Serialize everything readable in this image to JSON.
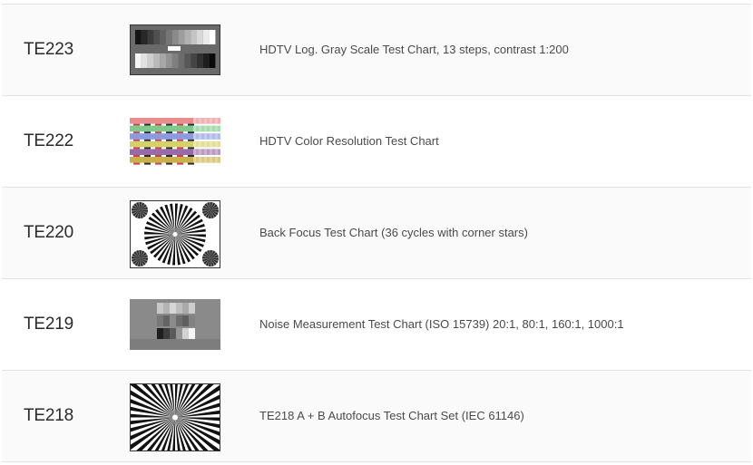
{
  "products": [
    {
      "code": "TE223",
      "title": "HDTV Log. Gray Scale Test Chart, 13 steps, contrast 1:200",
      "thumbnail": "gray-scale-chart"
    },
    {
      "code": "TE222",
      "title": "HDTV Color Resolution Test Chart",
      "thumbnail": "color-resolution-chart"
    },
    {
      "code": "TE220",
      "title": "Back Focus Test Chart (36 cycles with corner stars)",
      "thumbnail": "siemens-star-corner-chart"
    },
    {
      "code": "TE219",
      "title": "Noise Measurement Test Chart (ISO 15739) 20:1, 80:1, 160:1, 1000:1",
      "thumbnail": "noise-measurement-chart"
    },
    {
      "code": "TE218",
      "title": "TE218 A + B Autofocus Test Chart Set (IEC 61146)",
      "thumbnail": "siemens-star-chart"
    }
  ]
}
